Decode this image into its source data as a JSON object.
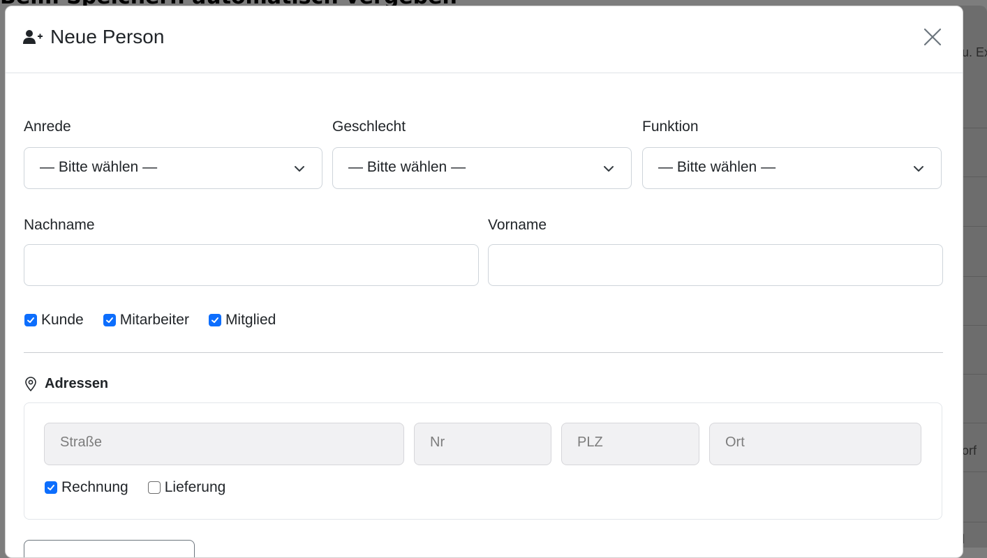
{
  "background": {
    "heading": "Beim Speichern automatisch vergeben",
    "right_texts": [
      "u. Ex",
      "orf",
      "l"
    ]
  },
  "modal": {
    "title": "Neue Person",
    "title_icon": "user-plus-icon",
    "close_icon": "close-icon"
  },
  "form": {
    "anrede": {
      "label": "Anrede",
      "value": "— Bitte wählen —"
    },
    "geschlecht": {
      "label": "Geschlecht",
      "value": "— Bitte wählen —"
    },
    "funktion": {
      "label": "Funktion",
      "value": "— Bitte wählen —"
    },
    "nachname": {
      "label": "Nachname",
      "value": ""
    },
    "vorname": {
      "label": "Vorname",
      "value": ""
    },
    "roles": [
      {
        "label": "Kunde",
        "checked": true
      },
      {
        "label": "Mitarbeiter",
        "checked": true
      },
      {
        "label": "Mitglied",
        "checked": true
      }
    ]
  },
  "addresses": {
    "title": "Adressen",
    "icon": "map-pin-icon",
    "fields": {
      "strasse_placeholder": "Straße",
      "nr_placeholder": "Nr",
      "plz_placeholder": "PLZ",
      "ort_placeholder": "Ort"
    },
    "types": [
      {
        "label": "Rechnung",
        "checked": true
      },
      {
        "label": "Lieferung",
        "checked": false
      }
    ]
  },
  "colors": {
    "accent": "#0d6efd",
    "backdrop": "#7d7d7d",
    "input_border": "#ced4da",
    "disabled_input_bg": "#f1f1f3"
  }
}
